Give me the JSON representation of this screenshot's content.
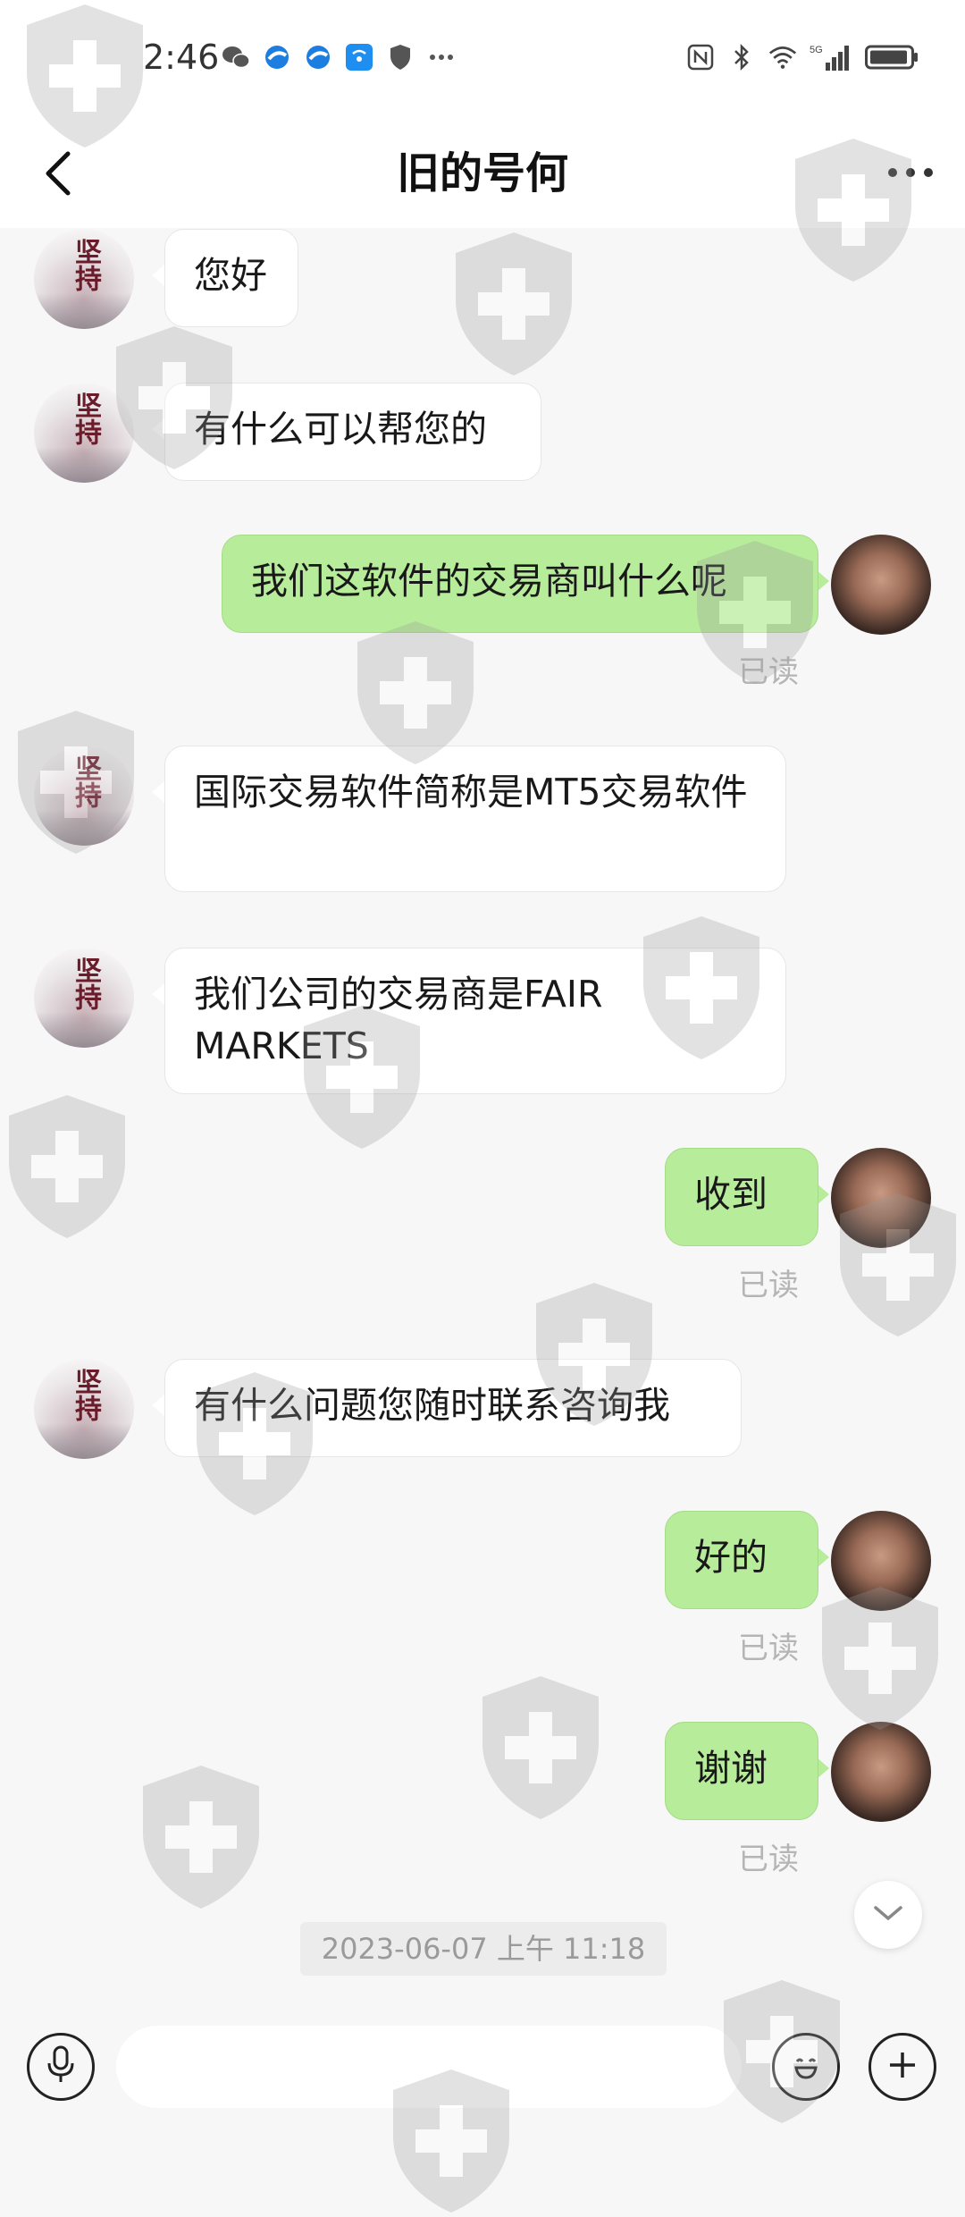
{
  "status_bar": {
    "time": "2:46",
    "left_icons": [
      "wechat-icon",
      "browser-icon",
      "browser-icon",
      "wifi-app-icon",
      "shield-icon",
      "more-dots-icon"
    ],
    "right_icons": [
      "nfc-icon",
      "bluetooth-icon",
      "wifi-icon",
      "signal-5g-icon",
      "battery-icon"
    ],
    "signal_label": "5G"
  },
  "header": {
    "title": "旧的号何",
    "back_icon": "chevron-left-icon",
    "more_icon": "more-dots-icon"
  },
  "messages": [
    {
      "side": "in",
      "text": "您好"
    },
    {
      "side": "in",
      "text": "有什么可以帮您的"
    },
    {
      "side": "out",
      "text": "我们这软件的交易商叫什么呢",
      "status": "已读"
    },
    {
      "side": "in",
      "text": "国际交易软件简称是MT5交易软件"
    },
    {
      "side": "in",
      "text": "我们公司的交易商是FAIRMARKETS"
    },
    {
      "side": "out",
      "text": "收到",
      "status": "已读"
    },
    {
      "side": "in",
      "text": "有什么问题您随时联系咨询我"
    },
    {
      "side": "out",
      "text": "好的",
      "status": "已读"
    },
    {
      "side": "out",
      "text": "谢谢",
      "status": "已读"
    }
  ],
  "contact_avatar": {
    "text": "坚持"
  },
  "timestamp": "2023-06-07 上午 11:18",
  "input_bar": {
    "mic_icon": "microphone-icon",
    "input_value": "",
    "emoji_icon": "emoji-icon",
    "plus_icon": "plus-icon"
  },
  "colors": {
    "outgoing_bubble": "#b7ec9a",
    "incoming_bubble": "#ffffff",
    "background": "#f7f7f7",
    "read_status": "#b5b5b5"
  }
}
